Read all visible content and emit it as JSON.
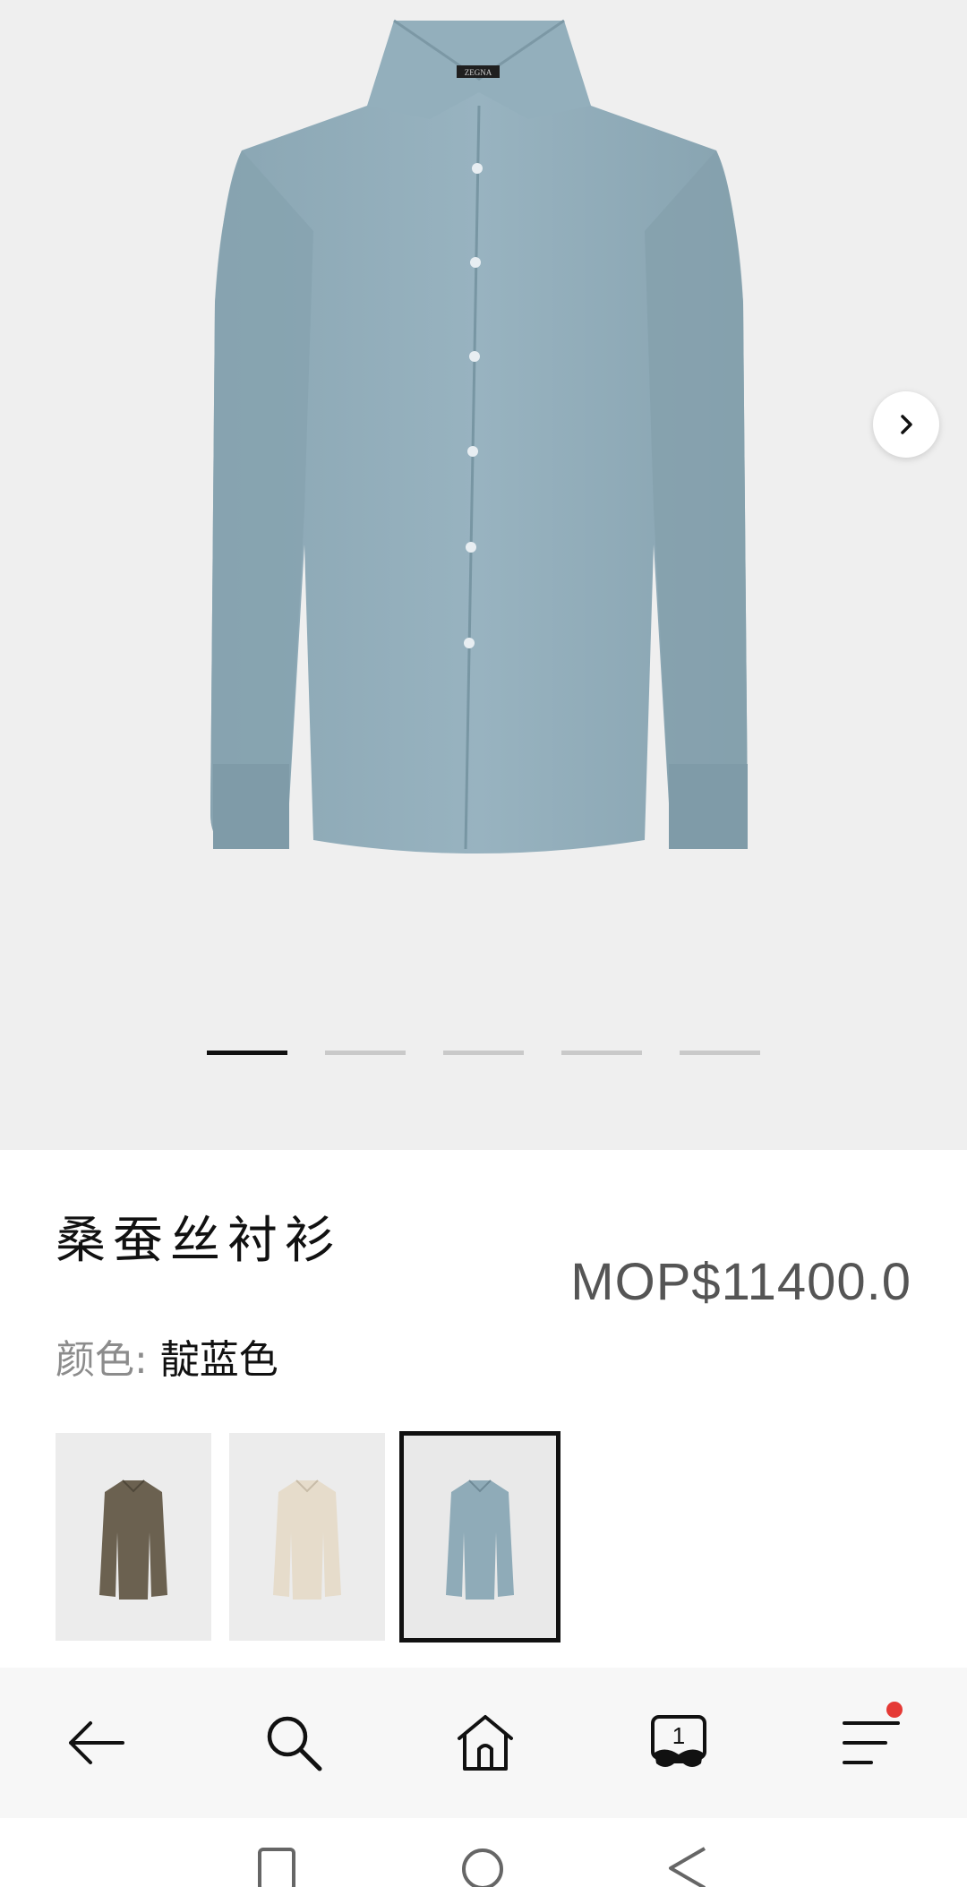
{
  "product": {
    "title": "桑蚕丝衬衫",
    "price": "MOP$11400.0",
    "color_label": "颜色: ",
    "color_value": "靛蓝色",
    "brand_tag": "ZEGNA"
  },
  "gallery": {
    "slide_count": 5,
    "active_index": 0,
    "shirt_color": "#93aeba"
  },
  "swatches": [
    {
      "name": "brown",
      "color": "#6b6150",
      "selected": false
    },
    {
      "name": "cream",
      "color": "#e6dccb",
      "selected": false
    },
    {
      "name": "blue",
      "color": "#8fabb8",
      "selected": true
    }
  ],
  "nav": {
    "tab_count": "1",
    "has_notification": true,
    "icons": [
      "back-arrow-icon",
      "search-icon",
      "home-icon",
      "tabs-icon",
      "menu-icon"
    ]
  },
  "system_nav": [
    "recent-apps-icon",
    "home-circle-icon",
    "back-triangle-icon"
  ]
}
